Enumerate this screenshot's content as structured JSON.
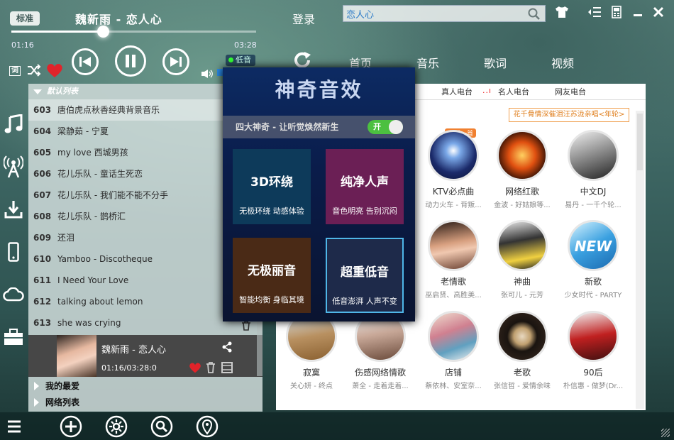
{
  "header": {
    "mode_label": "标准",
    "song_title": "魏新雨 - 恋人心",
    "login": "登录",
    "search": {
      "value": "恋人心"
    },
    "elapsed": "01:16",
    "duration": "03:28",
    "progress": 0.375
  },
  "controls": {
    "lyric_btn": "词",
    "sound_badge": "低音"
  },
  "nav": {
    "items": [
      "首页",
      "音乐",
      "歌词",
      "视频"
    ]
  },
  "sub_tabs": [
    "真人电台",
    "名人电台",
    "网友电台"
  ],
  "marquee": "花千骨情深催泪汪苏泷亲唱<年轮>",
  "playlist": {
    "header": "默认列表",
    "rows": [
      {
        "num": "603",
        "title": "唐伯虎点秋香经典背景音乐"
      },
      {
        "num": "604",
        "title": "梁静茹 - 宁夏"
      },
      {
        "num": "605",
        "title": "my love 西城男孩"
      },
      {
        "num": "606",
        "title": "花儿乐队 - 童话生死恋"
      },
      {
        "num": "607",
        "title": "花儿乐队 - 我们能不能不分手"
      },
      {
        "num": "608",
        "title": "花儿乐队 - 鹊桥汇"
      },
      {
        "num": "609",
        "title": "还泪"
      },
      {
        "num": "610",
        "title": "Yamboo - Discotheque"
      },
      {
        "num": "611",
        "title": "I Need Your Love"
      },
      {
        "num": "612",
        "title": "talking about lemon"
      },
      {
        "num": "613",
        "title": "she was crying"
      }
    ],
    "now_playing": {
      "title": "魏新雨 - 恋人心",
      "time": "01:16/03:28:0"
    },
    "footer": [
      "我的最爱",
      "网络列表"
    ]
  },
  "tiles": [
    {
      "label": "KTV必点曲",
      "sub": "动力火车 - 背叛...",
      "badge": "来唱一首"
    },
    {
      "label": "网络红歌",
      "sub": "金波 - 好姑娘等..."
    },
    {
      "label": "中文DJ",
      "sub": "易丹 - 一千个轮..."
    },
    {
      "label": "老情歌",
      "sub": "巫启贤、高胜美..."
    },
    {
      "label": "神曲",
      "sub": "张可儿 - 元芳"
    },
    {
      "label": "新歌",
      "sub": "少女时代 - PARTY",
      "badge": "NEW"
    },
    {
      "label": "寂寞",
      "sub": "关心妍 - 终点"
    },
    {
      "label": "伤感网络情歌",
      "sub": "萧全 - 走着走着..."
    },
    {
      "label": "店铺",
      "sub": "蔡依林、安室奈..."
    },
    {
      "label": "老歌",
      "sub": "张信哲 - 爱情余味"
    },
    {
      "label": "90后",
      "sub": "朴信惠 - 做梦(Dr..."
    }
  ],
  "fx": {
    "title": "神奇音效",
    "subtitle": "四大神奇 - 让听觉焕然新生",
    "toggle": "开",
    "cards": [
      {
        "title": "3D环绕",
        "desc": "无极环绕 动感体验"
      },
      {
        "title": "纯净人声",
        "desc": "音色明亮 告别沉闷"
      },
      {
        "title": "无极丽音",
        "desc": "智能均衡 身临其境"
      },
      {
        "title": "超重低音",
        "desc": "低音澎湃 人声不变"
      }
    ]
  },
  "colors": {
    "accent": "#e2232a",
    "card1": "#0d3a5a",
    "card2": "#6b1f55",
    "card3": "#4a2a16",
    "card4": "#1e2a4a",
    "card4_border": "#4fb6e8"
  }
}
